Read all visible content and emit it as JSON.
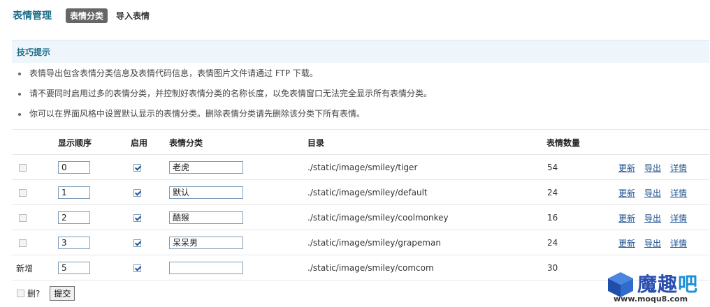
{
  "header": {
    "title": "表情管理",
    "tabs": [
      {
        "label": "表情分类",
        "active": true
      },
      {
        "label": "导入表情",
        "active": false
      }
    ]
  },
  "tips": {
    "title": "技巧提示",
    "items": [
      "表情导出包含表情分类信息及表情代码信息，表情图片文件请通过 FTP 下载。",
      "请不要同时启用过多的表情分类，并控制好表情分类的名称长度，以免表情窗口无法完全显示所有表情分类。",
      "你可以在界面风格中设置默认显示的表情分类。删除表情分类请先删除该分类下所有表情。"
    ]
  },
  "table": {
    "headers": {
      "order": "显示顺序",
      "enabled": "启用",
      "category": "表情分类",
      "directory": "目录",
      "count": "表情数量"
    },
    "rows": [
      {
        "order": "0",
        "enabled": true,
        "name": "老虎",
        "directory": "./static/image/smiley/tiger",
        "count": "54"
      },
      {
        "order": "1",
        "enabled": true,
        "name": "默认",
        "directory": "./static/image/smiley/default",
        "count": "24"
      },
      {
        "order": "2",
        "enabled": true,
        "name": "酷猴",
        "directory": "./static/image/smiley/coolmonkey",
        "count": "16"
      },
      {
        "order": "3",
        "enabled": true,
        "name": "呆呆男",
        "directory": "./static/image/smiley/grapeman",
        "count": "24"
      }
    ],
    "actions": {
      "update": "更新",
      "export": "导出",
      "detail": "详情"
    },
    "new_row": {
      "label": "新增",
      "order": "5",
      "enabled": true,
      "name": "",
      "directory": "./static/image/smiley/comcom",
      "count": "30"
    }
  },
  "footer": {
    "delete_label": "删?",
    "submit_label": "提交"
  },
  "watermark": {
    "text_main": "魔趣",
    "text_accent": "吧",
    "url": "www.moqu8.com"
  }
}
